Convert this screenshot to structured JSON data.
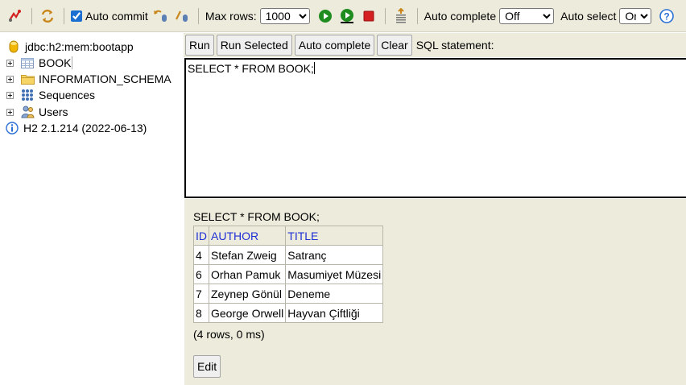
{
  "toolbar": {
    "icons": [
      "disconnect-icon",
      "refresh-icon",
      "rollback-icon",
      "commit-icon",
      "run-icon",
      "run-selected-icon",
      "stop-icon",
      "history-icon",
      "help-icon"
    ],
    "auto_commit_label": "Auto commit",
    "auto_commit_checked": true,
    "max_rows_label": "Max rows:",
    "max_rows_value": "1000",
    "auto_complete_label": "Auto complete",
    "auto_complete_value": "Off",
    "auto_select_label": "Auto select",
    "auto_select_value": "On",
    "colors": {
      "bar": "#ecebdc",
      "run_green": "#1e8c1e",
      "stop_red": "#d42020",
      "help_blue": "#2a6fd6"
    }
  },
  "tree": {
    "connection": "jdbc:h2:mem:bootapp",
    "items": [
      {
        "label": "BOOK",
        "icon": "table-icon"
      },
      {
        "label": "INFORMATION_SCHEMA",
        "icon": "folder-icon"
      },
      {
        "label": "Sequences",
        "icon": "sequences-icon"
      },
      {
        "label": "Users",
        "icon": "users-icon"
      }
    ],
    "version": "H2 2.1.214 (2022-06-13)"
  },
  "query": {
    "buttons": {
      "run": "Run",
      "run_selected": "Run Selected",
      "auto_complete": "Auto complete",
      "clear": "Clear"
    },
    "sql_label": "SQL statement:",
    "sql_text": "SELECT * FROM BOOK;"
  },
  "result": {
    "statement": "SELECT * FROM BOOK;",
    "columns": [
      "ID",
      "AUTHOR",
      "TITLE"
    ],
    "rows": [
      [
        "4",
        "Stefan Zweig",
        "Satranç"
      ],
      [
        "6",
        "Orhan Pamuk",
        "Masumiyet Müzesi"
      ],
      [
        "7",
        "Zeynep Gönül",
        "Deneme"
      ],
      [
        "8",
        "George Orwell",
        "Hayvan Çiftliği"
      ]
    ],
    "summary": "(4 rows, 0 ms)",
    "edit_label": "Edit"
  }
}
